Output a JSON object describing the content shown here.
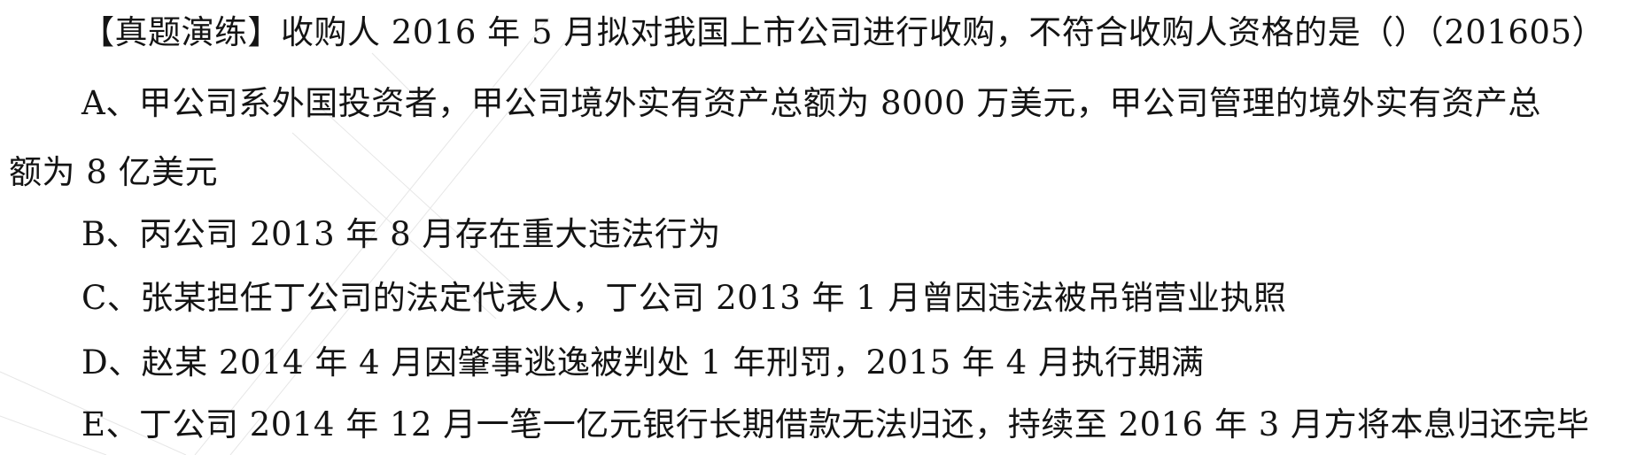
{
  "question": {
    "stem": "【真题演练】收购人 2016 年 5 月拟对我国上市公司进行收购，不符合收购人资格的是（）（201605）",
    "options": [
      {
        "line1": "A、甲公司系外国投资者，甲公司境外实有资产总额为 8000 万美元，甲公司管理的境外实有资产总",
        "line2": "额为 8 亿美元"
      },
      {
        "text": "B、丙公司 2013 年 8 月存在重大违法行为"
      },
      {
        "text": "C、张某担任丁公司的法定代表人，丁公司 2013 年 1 月曾因违法被吊销营业执照"
      },
      {
        "text": "D、赵某 2014 年 4 月因肇事逃逸被判处 1 年刑罚，2015 年 4 月执行期满"
      },
      {
        "text": "E、丁公司 2014 年 12 月一笔一亿元银行长期借款无法归还，持续至 2016 年 3 月方将本息归还完毕"
      }
    ]
  }
}
